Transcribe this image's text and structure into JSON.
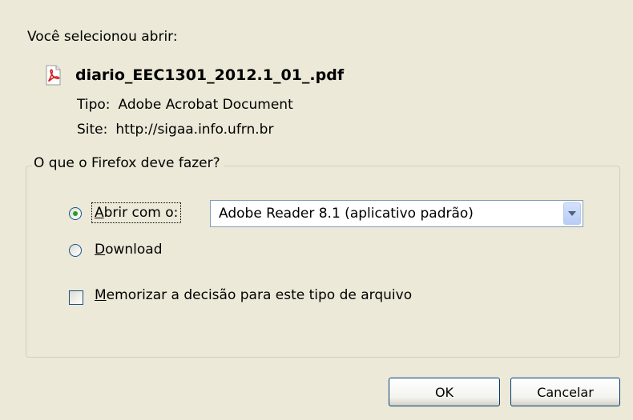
{
  "dialog": {
    "intro": "Você selecionou abrir:",
    "filename": "diario_EEC1301_2012.1_01_.pdf",
    "type_label": "Tipo:",
    "type_value": "Adobe Acrobat Document",
    "site_label": "Site:",
    "site_value": "http://sigaa.info.ufrn.br",
    "file_icon": "pdf-icon"
  },
  "action_group": {
    "legend": "O que o Firefox deve fazer?",
    "open_with": {
      "accesskey": "A",
      "label_rest": "brir com o:",
      "checked": true
    },
    "app_select": {
      "selected": "Adobe Reader 8.1 (aplicativo padrão)"
    },
    "download": {
      "accesskey": "D",
      "label_rest": "ownload",
      "checked": false
    },
    "remember": {
      "accesskey": "M",
      "label_rest": "emorizar a decisão para este tipo de arquivo",
      "checked": false
    }
  },
  "buttons": {
    "ok": "OK",
    "cancel": "Cancelar"
  }
}
